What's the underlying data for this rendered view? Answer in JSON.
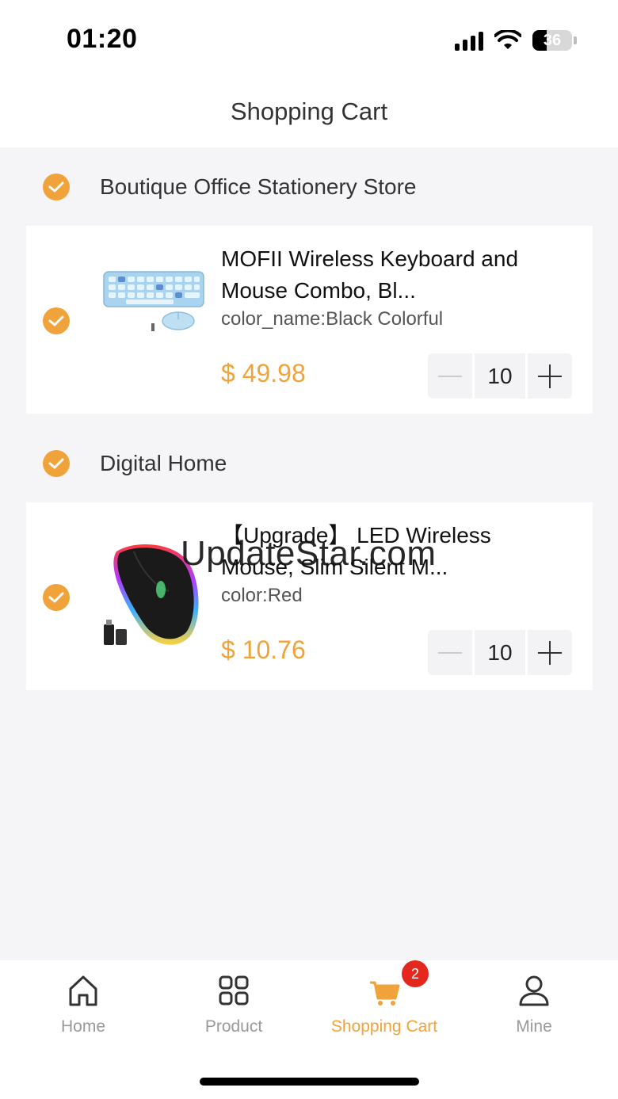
{
  "status_bar": {
    "time": "01:20",
    "battery": "36"
  },
  "nav": {
    "title": "Shopping Cart"
  },
  "stores": [
    {
      "name": "Boutique Office Stationery Store",
      "item": {
        "title": "MOFII Wireless Keyboard and Mouse Combo, Bl...",
        "spec": "color_name:Black Colorful",
        "price": "$ 49.98",
        "quantity": "10"
      }
    },
    {
      "name": "Digital Home",
      "item": {
        "title": "【Upgrade】 LED Wireless Mouse, Slim Silent M...",
        "spec": "color:Red",
        "price": "$ 10.76",
        "quantity": "10"
      }
    }
  ],
  "watermark": "UpdateStar.com",
  "tab_bar": {
    "tabs": [
      {
        "label": "Home",
        "icon": "home-icon"
      },
      {
        "label": "Product",
        "icon": "grid-icon"
      },
      {
        "label": "Shopping Cart",
        "icon": "cart-icon",
        "badge": "2",
        "active": true
      },
      {
        "label": "Mine",
        "icon": "person-icon"
      }
    ]
  },
  "colors": {
    "accent": "#f0a33b",
    "badge": "#e5281e",
    "background": "#f5f5f7"
  }
}
